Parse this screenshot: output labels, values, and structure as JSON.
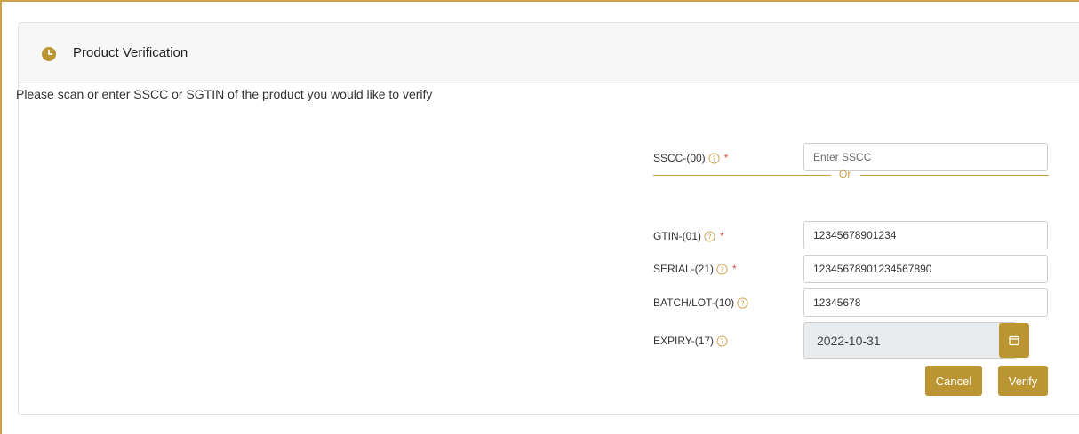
{
  "header": {
    "title": "Product Verification",
    "icon": "clock-icon"
  },
  "instructions": "Please scan or enter SSCC or SGTIN of the product you would like to verify",
  "form": {
    "sscc": {
      "label": "SSCC-(00)",
      "required": "*",
      "value": "",
      "placeholder": "Enter SSCC"
    },
    "separator": "Or",
    "gtin": {
      "label": "GTIN-(01)",
      "required": "*",
      "value": "12345678901234"
    },
    "serial": {
      "label": "SERIAL-(21)",
      "required": "*",
      "value": "12345678901234567890"
    },
    "batch": {
      "label": "BATCH/LOT-(10)",
      "value": "12345678"
    },
    "expiry": {
      "label": "EXPIRY-(17)",
      "value": "2022-10-31"
    }
  },
  "actions": {
    "cancel_label": "Cancel",
    "verify_label": "Verify"
  },
  "colors": {
    "accent": "#bb9531",
    "required": "#d9534f",
    "frame": "#c9a24a"
  }
}
